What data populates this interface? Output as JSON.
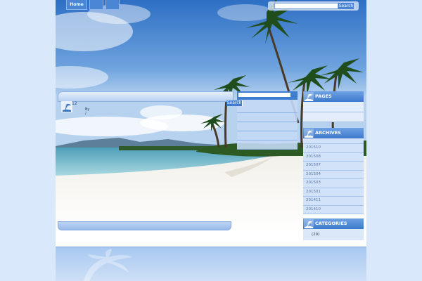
{
  "nav": {
    "home_label": "Home"
  },
  "top_search": {
    "button_label": "Search",
    "placeholder": ""
  },
  "post": {
    "date_day": "12",
    "byline": "By",
    "byline_sub": "/"
  },
  "mid_sidebar": {
    "search_button": "Search"
  },
  "pages": {
    "title": "PAGES"
  },
  "archives": {
    "title": "ARCHIVES",
    "items": [
      "201510",
      "201508",
      "201507",
      "201504",
      "201503",
      "201501",
      "201411",
      "201410"
    ]
  },
  "categories": {
    "title": "CATEGORIES",
    "items": [
      "(29)"
    ]
  },
  "colors": {
    "accent": "#3c78cc",
    "light": "#d2e2f8",
    "bg": "#d9e8fa"
  }
}
